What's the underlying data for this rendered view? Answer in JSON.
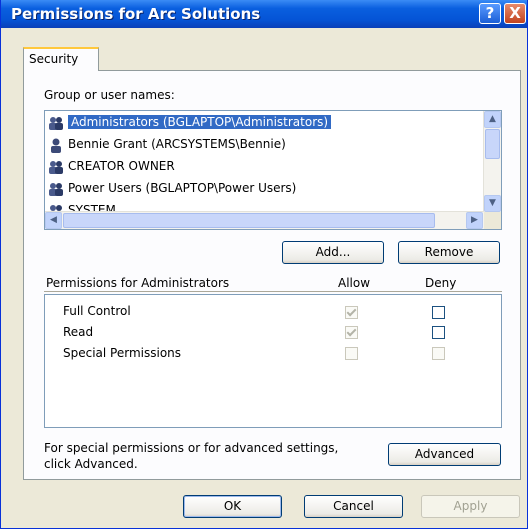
{
  "window": {
    "title": "Permissions for Arc Solutions",
    "help_label": "?",
    "close_label": "X"
  },
  "tabs": [
    {
      "label": "Security"
    }
  ],
  "group_label": "Group or user names:",
  "users": [
    {
      "label": "Administrators (BGLAPTOP\\Administrators)",
      "selected": true
    },
    {
      "label": "Bennie Grant (ARCSYSTEMS\\Bennie)"
    },
    {
      "label": "CREATOR OWNER"
    },
    {
      "label": "Power Users (BGLAPTOP\\Power Users)"
    },
    {
      "label": "SYSTEM"
    }
  ],
  "buttons": {
    "add": "Add...",
    "remove": "Remove",
    "advanced": "Advanced",
    "ok": "OK",
    "cancel": "Cancel",
    "apply": "Apply"
  },
  "permissions": {
    "header": "Permissions for Administrators",
    "allow_label": "Allow",
    "deny_label": "Deny",
    "rows": [
      {
        "name": "Full Control",
        "allow": true,
        "deny": false
      },
      {
        "name": "Read",
        "allow": true,
        "deny": false
      },
      {
        "name": "Special Permissions",
        "allow": false,
        "deny": false
      }
    ]
  },
  "advanced_text": {
    "line1": "For special permissions or for advanced settings,",
    "line2": "click Advanced."
  },
  "scroll_glyphs": {
    "up": "▲",
    "down": "▼",
    "left": "◀",
    "right": "▶"
  }
}
